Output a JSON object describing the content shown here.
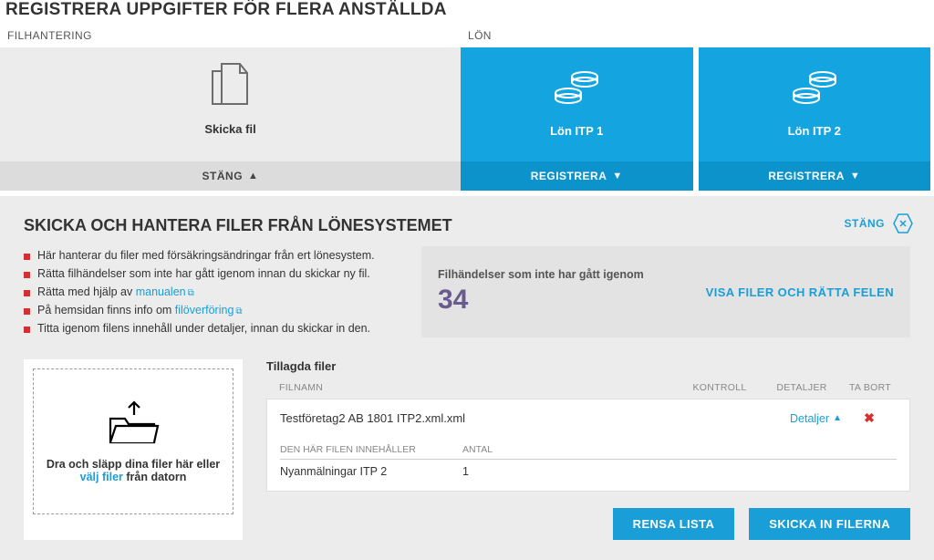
{
  "main_title": "REGISTRERA UPPGIFTER FÖR FLERA ANSTÄLLDA",
  "columns": {
    "left_label": "FILHANTERING",
    "right_label": "LÖN"
  },
  "cards": {
    "file": {
      "title": "Skicka fil",
      "action": "STÄNG"
    },
    "itp1": {
      "title": "Lön ITP 1",
      "action": "REGISTRERA"
    },
    "itp2": {
      "title": "Lön ITP 2",
      "action": "REGISTRERA"
    }
  },
  "section": {
    "title": "SKICKA OCH HANTERA FILER FRÅN LÖNESYSTEMET",
    "close": "STÄNG",
    "bullets": {
      "b1": "Här hanterar du filer med försäkringsändringar från ert lönesystem.",
      "b2": "Rätta filhändelser som inte har gått igenom innan du skickar ny fil.",
      "b3_pre": "Rätta med hjälp av ",
      "b3_link": "manualen",
      "b4_pre": "På hemsidan finns info om ",
      "b4_link": "filöverföring",
      "b5": "Titta igenom filens innehåll under detaljer, innan du skickar in den."
    },
    "events": {
      "label": "Filhändelser som inte har gått igenom",
      "count": "34",
      "action": "VISA FILER OCH RÄTTA FELEN"
    }
  },
  "dropzone": {
    "line1": "Dra och släpp dina filer här eller",
    "link": "välj filer",
    "line2_suffix": " från datorn"
  },
  "files": {
    "title": "Tillagda filer",
    "headers": {
      "name": "FILNAMN",
      "kontroll": "KONTROLL",
      "detaljer": "DETALJER",
      "tabort": "TA BORT"
    },
    "row": {
      "name": "Testföretag2 AB 1801 ITP2.xml.xml",
      "detaljer": "Detaljer"
    },
    "sub_headers": {
      "c1": "DEN HÄR FILEN INNEHÅLLER",
      "c2": "ANTAL"
    },
    "sub_row": {
      "c1": "Nyanmälningar ITP 2",
      "c2": "1"
    }
  },
  "actions": {
    "clear": "RENSA LISTA",
    "send": "SKICKA IN FILERNA"
  }
}
